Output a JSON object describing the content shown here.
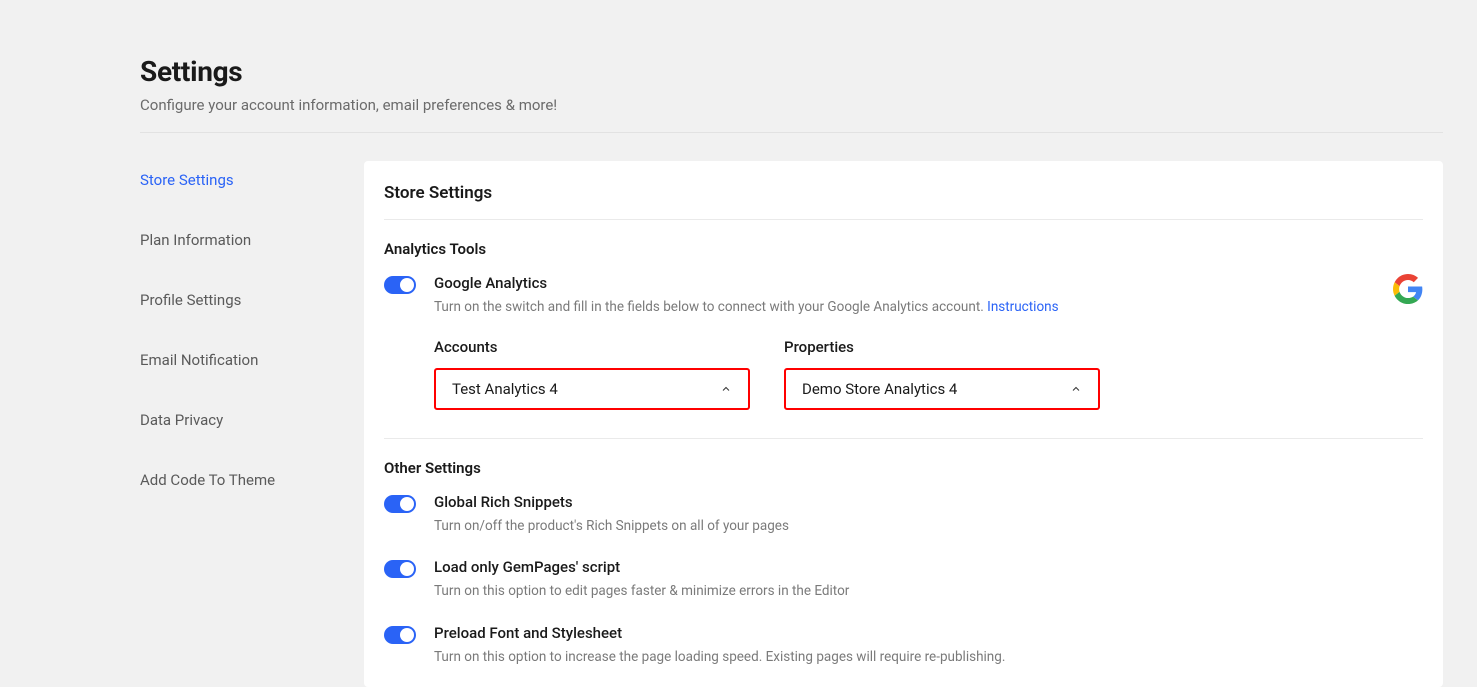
{
  "header": {
    "title": "Settings",
    "subtitle": "Configure your account information, email preferences & more!"
  },
  "sidebar": {
    "items": [
      {
        "label": "Store Settings",
        "active": true
      },
      {
        "label": "Plan Information",
        "active": false
      },
      {
        "label": "Profile Settings",
        "active": false
      },
      {
        "label": "Email Notification",
        "active": false
      },
      {
        "label": "Data Privacy",
        "active": false
      },
      {
        "label": "Add Code To Theme",
        "active": false
      }
    ]
  },
  "main": {
    "heading": "Store Settings",
    "analytics": {
      "section_title": "Analytics Tools",
      "ga_label": "Google Analytics",
      "ga_desc": "Turn on the switch and fill in the fields below to connect with your Google Analytics account. ",
      "ga_link": "Instructions",
      "accounts_label": "Accounts",
      "accounts_value": "Test Analytics 4",
      "properties_label": "Properties",
      "properties_value": "Demo Store Analytics 4"
    },
    "other": {
      "section_title": "Other Settings",
      "items": [
        {
          "label": "Global Rich Snippets",
          "desc": "Turn on/off the product's Rich Snippets on all of your pages"
        },
        {
          "label": "Load only GemPages' script",
          "desc": "Turn on this option to edit pages faster & minimize errors in the Editor"
        },
        {
          "label": "Preload Font and Stylesheet",
          "desc": "Turn on this option to increase the page loading speed. Existing pages will require re-publishing."
        }
      ]
    }
  }
}
